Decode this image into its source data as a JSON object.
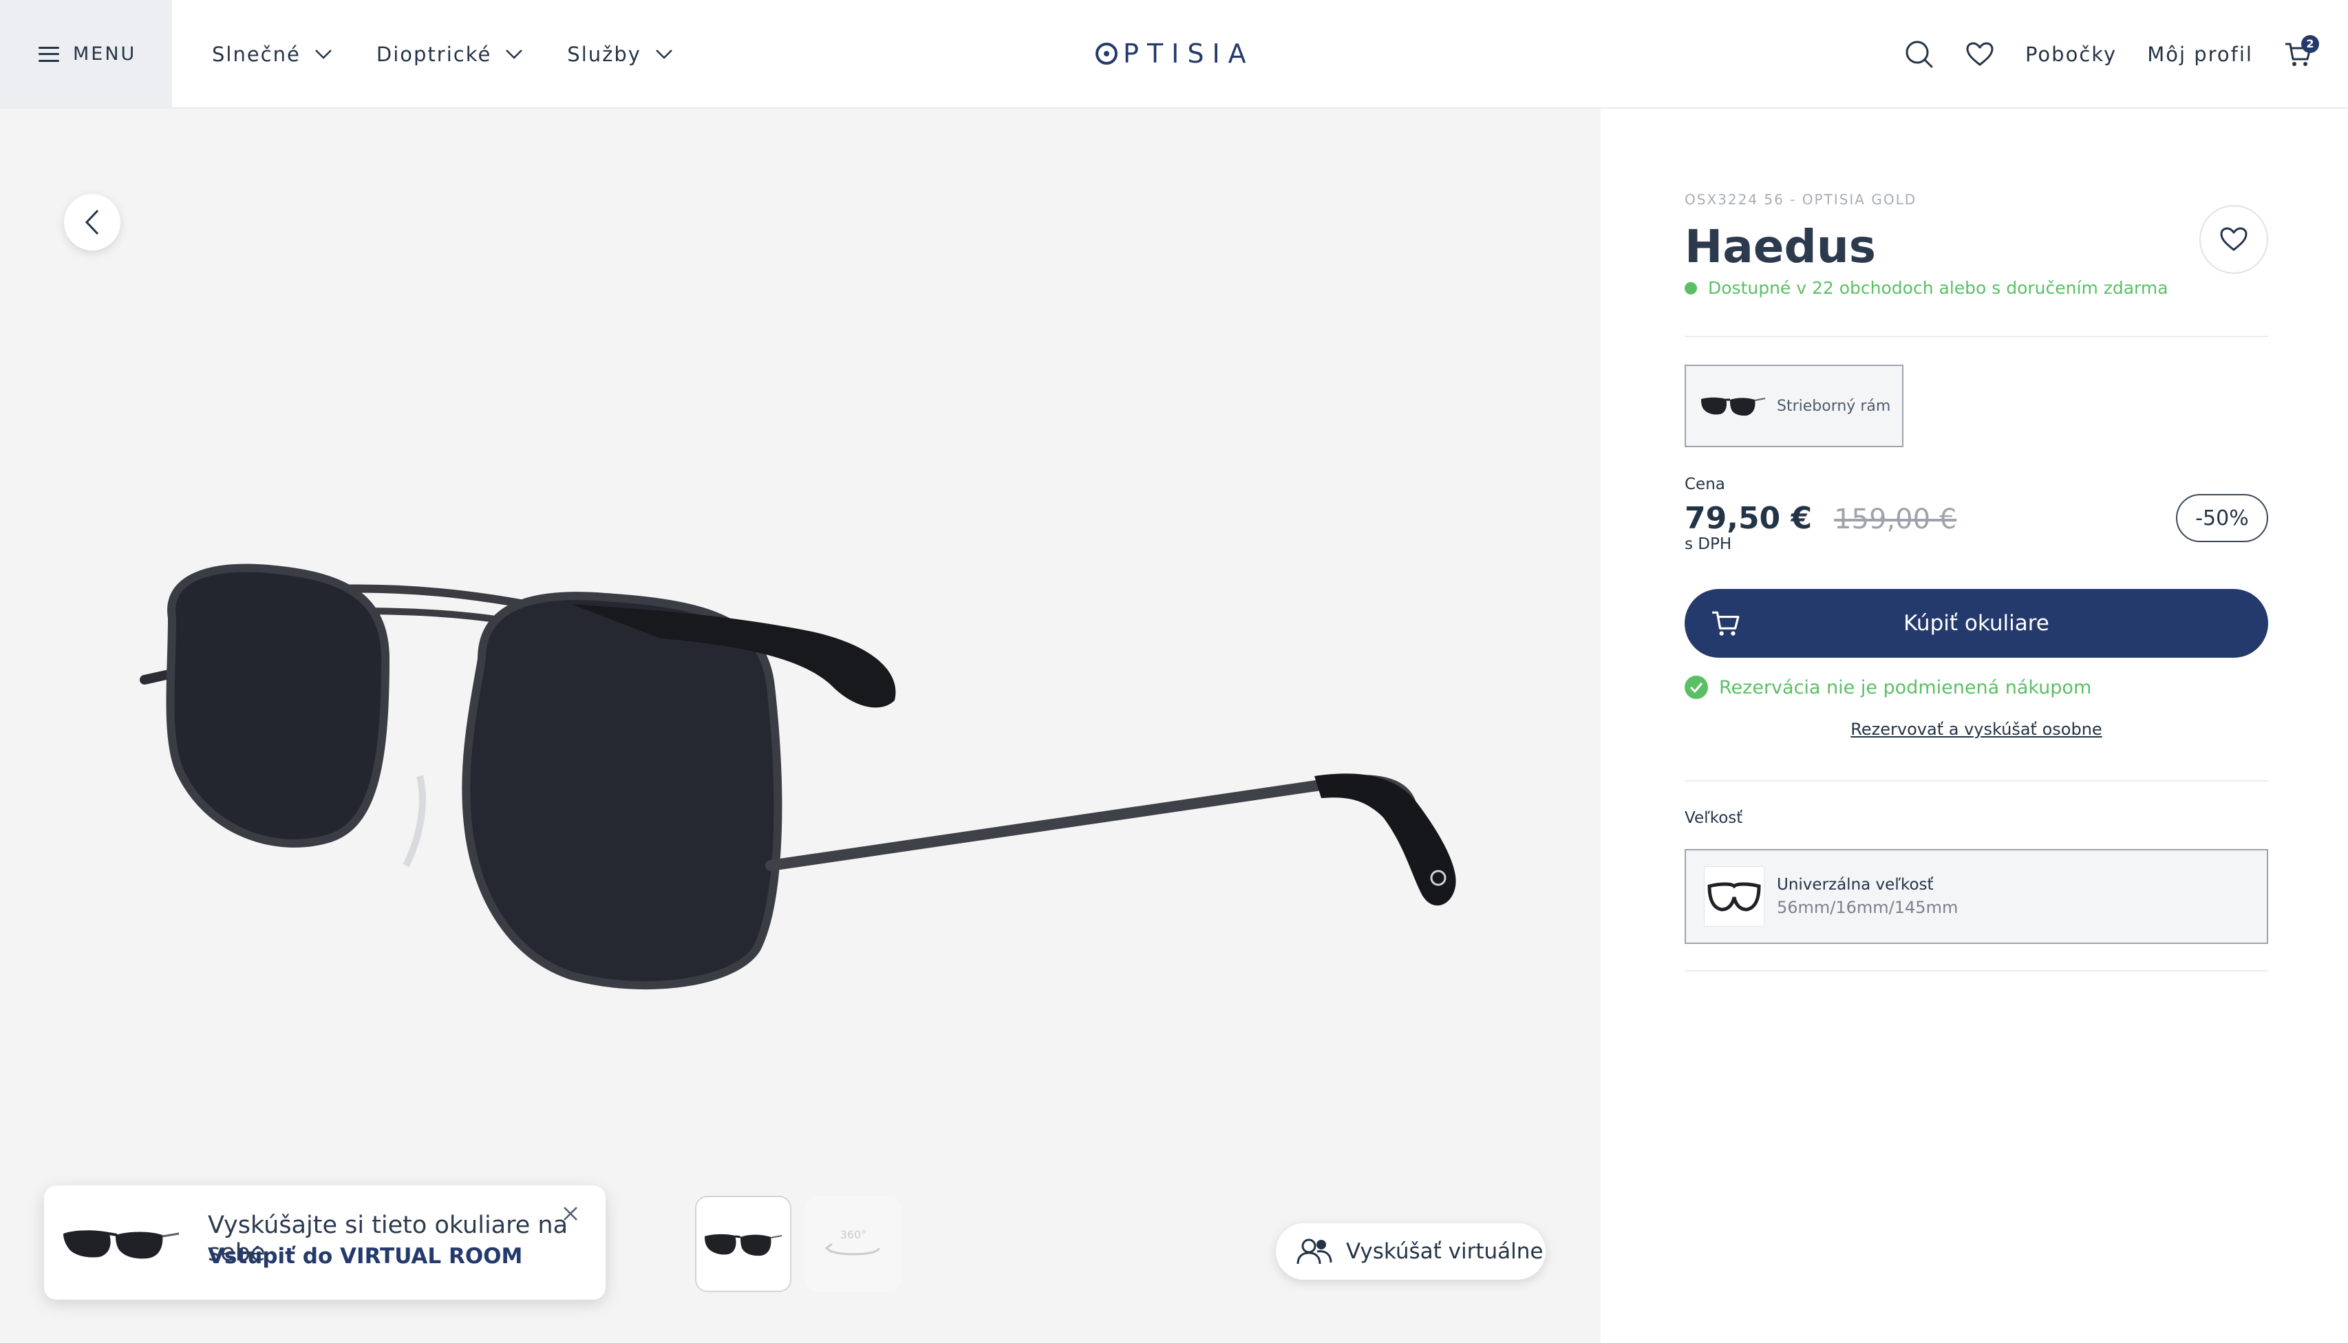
{
  "header": {
    "menu_label": "MENU",
    "nav": [
      {
        "label": "Slnečné"
      },
      {
        "label": "Dioptrické"
      },
      {
        "label": "Služby"
      }
    ],
    "logo_text": "PTISIA",
    "branches_label": "Pobočky",
    "profile_label": "Môj profil",
    "cart_count": "2",
    "icons": {
      "menu": "hamburger-icon",
      "search": "search-icon",
      "wishlist": "heart-icon",
      "cart": "cart-icon"
    }
  },
  "gallery": {
    "thumb_360_label": "360°",
    "popup": {
      "text": "Vyskúšajte si tieto okuliare na sebe",
      "link": "Vstúpiť do VIRTUAL ROOM"
    },
    "try_button_label": "Vyskúšať virtuálne"
  },
  "product": {
    "sku": "OSX3224 56 - OPTISIA GOLD",
    "name": "Haedus",
    "availability": "Dostupné v 22 obchodoch alebo s doručením zdarma",
    "variant_label": "Strieborný rám",
    "price_label": "Cena",
    "price_now": "79,50 €",
    "price_old": "159,00 €",
    "vat_note": "s DPH",
    "discount": "-50%",
    "buy_label": "Kúpiť okuliare",
    "reservation_note": "Rezervácia nie je podmienená nákupom",
    "reserve_link": "Rezervovať a vyskúšať osobne",
    "size_label": "Veľkosť",
    "size_name": "Univerzálna veľkosť",
    "size_dims": "56mm/16mm/145mm"
  },
  "colors": {
    "brand_navy": "#243a6c",
    "text_dark": "#243447",
    "available_green": "#5bbf65",
    "gallery_bg": "#f4f4f4"
  }
}
